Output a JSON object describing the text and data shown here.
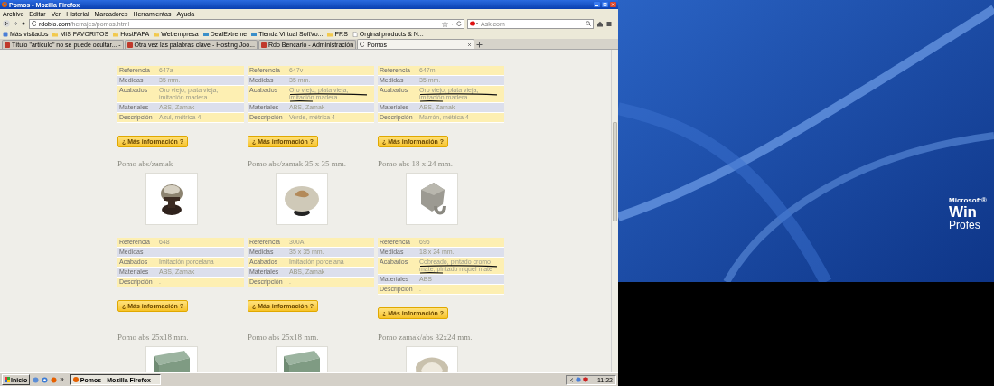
{
  "browser": {
    "title": "Pomos - Mozilla Firefox",
    "menu": [
      "Archivo",
      "Editar",
      "Ver",
      "Historial",
      "Marcadores",
      "Herramientas",
      "Ayuda"
    ],
    "url_host": "rdoblo.com",
    "url_path": "/herrajes/pomos.html",
    "search_placeholder": "Ask.com",
    "bookmarks": [
      {
        "kind": "smart",
        "label": "Más visitados"
      },
      {
        "kind": "folder",
        "label": "MIS FAVORITOS"
      },
      {
        "kind": "folder",
        "label": "HostPAPA"
      },
      {
        "kind": "folder",
        "label": "Webempresa"
      },
      {
        "kind": "site",
        "label": "DealExtreme"
      },
      {
        "kind": "site",
        "label": "Tienda Virtual SoftVo..."
      },
      {
        "kind": "folder",
        "label": "PRS"
      },
      {
        "kind": "page",
        "label": "Orginal products & N..."
      }
    ],
    "tabs": [
      {
        "label": "Título \"artículo\" no se puede ocultar... -",
        "selected": false
      },
      {
        "label": "Otra vez las palabras clave - Hosting Joo...",
        "selected": false
      },
      {
        "label": "Rdo Bencario - Administración",
        "selected": false
      },
      {
        "label": "Pomos",
        "selected": true
      }
    ]
  },
  "spec_groups": [
    {
      "tables": [
        {
          "rows": [
            {
              "label": "Referencia",
              "value": "647a",
              "marked": false
            },
            {
              "label": "Medidas",
              "value": "35 mm.",
              "marked": false
            },
            {
              "label": "Acabados",
              "value": "Oro viejo, plata vieja, imitación madera.",
              "marked": false
            },
            {
              "label": "Materiales",
              "value": "ABS, Zamak",
              "marked": false
            },
            {
              "label": "Descripción",
              "value": "Azul, métrica 4",
              "marked": false
            }
          ],
          "button": "¿ Más información ?"
        },
        {
          "rows": [
            {
              "label": "Referencia",
              "value": "647v",
              "marked": false
            },
            {
              "label": "Medidas",
              "value": "35 mm.",
              "marked": false
            },
            {
              "label": "Acabados",
              "value": "Oro viejo, plata vieja, imitación madera.",
              "marked": true
            },
            {
              "label": "Materiales",
              "value": "ABS, Zamak",
              "marked": false
            },
            {
              "label": "Descripción",
              "value": "Verde, métrica 4",
              "marked": false
            }
          ],
          "button": "¿ Más información ?"
        },
        {
          "rows": [
            {
              "label": "Referencia",
              "value": "647m",
              "marked": false
            },
            {
              "label": "Medidas",
              "value": "35 mm.",
              "marked": false
            },
            {
              "label": "Acabados",
              "value": "Oro viejo, plata vieja, imitación madera.",
              "marked": true
            },
            {
              "label": "Materiales",
              "value": "ABS, Zamak",
              "marked": false
            },
            {
              "label": "Descripción",
              "value": "Marrón, métrica 4",
              "marked": false
            }
          ],
          "button": "¿ Más información ?"
        }
      ]
    },
    {
      "tables": [
        {
          "rows": [
            {
              "label": "Referencia",
              "value": "648",
              "marked": false
            },
            {
              "label": "Medidas",
              "value": "",
              "marked": false
            },
            {
              "label": "Acabados",
              "value": "Imitación porcelana",
              "marked": false
            },
            {
              "label": "Materiales",
              "value": "ABS, Zamak",
              "marked": false
            },
            {
              "label": "Descripción",
              "value": ".",
              "marked": false
            }
          ],
          "button": "¿ Más información ?"
        },
        {
          "rows": [
            {
              "label": "Referencia",
              "value": "300A",
              "marked": false
            },
            {
              "label": "Medidas",
              "value": "35 x 35 mm.",
              "marked": false
            },
            {
              "label": "Acabados",
              "value": "Imitación porcelana",
              "marked": false
            },
            {
              "label": "Materiales",
              "value": "ABS, Zamak",
              "marked": false
            },
            {
              "label": "Descripción",
              "value": ".",
              "marked": false
            }
          ],
          "button": "¿ Más información ?"
        },
        {
          "rows": [
            {
              "label": "Referencia",
              "value": "695",
              "marked": false
            },
            {
              "label": "Medidas",
              "value": "18 x 24 mm.",
              "marked": false
            },
            {
              "label": "Acabados",
              "value": "Cobreado, pintado cromo mate, pintado níquel mate",
              "marked": true
            },
            {
              "label": "Materiales",
              "value": "ABS",
              "marked": false
            },
            {
              "label": "Descripción",
              "value": ".",
              "marked": false
            }
          ],
          "button": "¿ Más información ?"
        }
      ]
    }
  ],
  "product_groups": [
    {
      "titles": [
        "Pomo abs/zamak",
        "Pomo abs/zamak 35 x 35 mm.",
        "Pomo abs 18 x 24 mm."
      ]
    },
    {
      "titles": [
        "Pomo abs 25x18 mm.",
        "Pomo abs 25x18 mm.",
        "Pomo zamak/abs 32x24 mm."
      ]
    }
  ],
  "taskbar": {
    "start": "Inicio",
    "chevron": "»",
    "task": "Pomos - Mozilla Firefox",
    "clock": "11:22"
  },
  "desktop": {
    "logo_lines": [
      "Microsoft®",
      "Win",
      "Profes"
    ]
  }
}
